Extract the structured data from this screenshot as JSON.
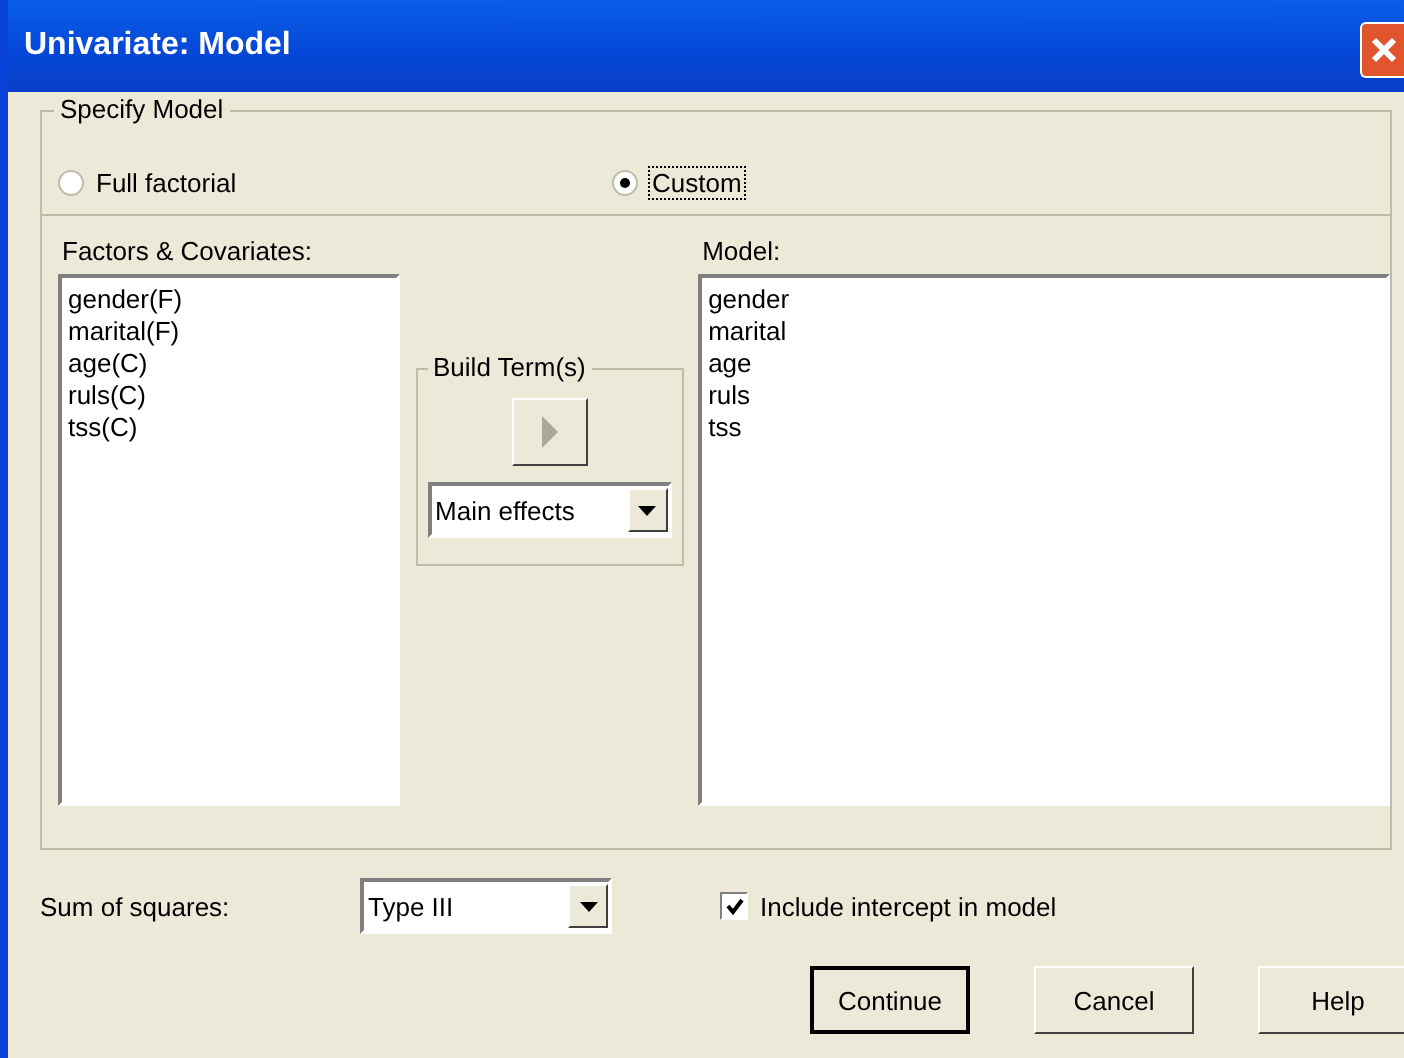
{
  "window": {
    "title": "Univariate: Model"
  },
  "specify_model": {
    "legend": "Specify Model",
    "options": [
      {
        "label": "Full factorial",
        "selected": false
      },
      {
        "label": "Custom",
        "selected": true
      }
    ]
  },
  "factors": {
    "label": "Factors & Covariates:",
    "items": [
      "gender(F)",
      "marital(F)",
      "age(C)",
      "ruls(C)",
      "tss(C)"
    ]
  },
  "build_terms": {
    "legend": "Build Term(s)",
    "type_value": "Main effects"
  },
  "model": {
    "label": "Model:",
    "items": [
      "gender",
      "marital",
      "age",
      "ruls",
      "tss"
    ]
  },
  "sum_of_squares": {
    "label": "Sum of squares:",
    "value": "Type III"
  },
  "include_intercept": {
    "label": "Include intercept in model",
    "checked": true
  },
  "buttons": [
    {
      "label": "Continue",
      "default": true
    },
    {
      "label": "Cancel",
      "default": false
    },
    {
      "label": "Help",
      "default": false
    }
  ]
}
